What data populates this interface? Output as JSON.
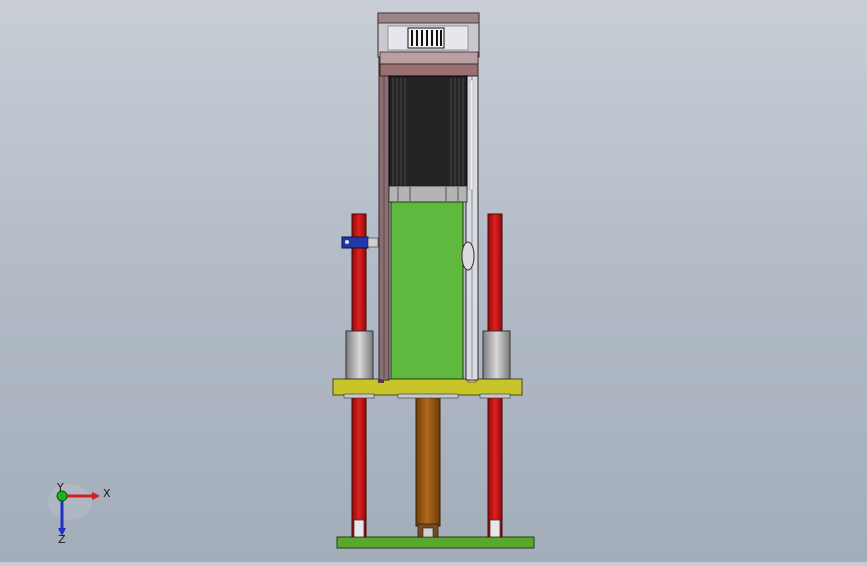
{
  "viewport": {
    "background_top": "#c9ced6",
    "background_bottom": "#a3adba"
  },
  "model": {
    "colors": {
      "frame": "#8a6f72",
      "frame_dark": "#5b3b3f",
      "motor_body": "#232323",
      "motor_fins": "#3a3a3a",
      "green_plate": "#5fb93e",
      "red_rod": "#d01818",
      "bushing": "#a8a8a8",
      "yellow_plate": "#c8c52a",
      "screw_shaft": "#9b5a12",
      "base_plate": "#58a82c",
      "sensor": "#1f3aa8"
    }
  },
  "triad": {
    "x_label": "X",
    "y_label": "Y",
    "z_label": "Z",
    "x_color": "#d02020",
    "y_color": "#20b020",
    "z_color": "#2030c0"
  }
}
